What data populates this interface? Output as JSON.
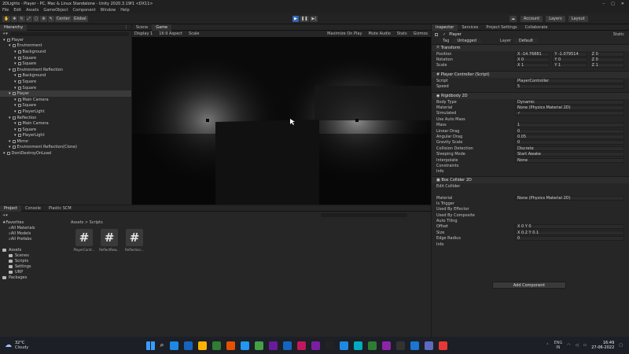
{
  "window": {
    "title": "2DLights - Player - PC, Mac & Linux Standalone - Unity 2020.3.19f1 <DX11>"
  },
  "menu": [
    "File",
    "Edit",
    "Assets",
    "GameObject",
    "Component",
    "Window",
    "Help"
  ],
  "toolbar": {
    "center_label": "Center",
    "global_label": "Global",
    "account_label": "Account",
    "layers_label": "Layers",
    "layout_label": "Layout"
  },
  "hierarchy": {
    "tab_label": "Hierarchy",
    "items": [
      {
        "label": "Player",
        "indent": 0,
        "selected": false
      },
      {
        "label": "Environment",
        "indent": 1,
        "selected": false
      },
      {
        "label": "Background",
        "indent": 2,
        "selected": false
      },
      {
        "label": "Square",
        "indent": 2,
        "selected": false
      },
      {
        "label": "Square",
        "indent": 2,
        "selected": false
      },
      {
        "label": "Environment Reflection",
        "indent": 1,
        "selected": false
      },
      {
        "label": "Background",
        "indent": 2,
        "selected": false
      },
      {
        "label": "Square",
        "indent": 2,
        "selected": false
      },
      {
        "label": "Square",
        "indent": 2,
        "selected": false
      },
      {
        "label": "Player",
        "indent": 1,
        "selected": true
      },
      {
        "label": "Main Camera",
        "indent": 2,
        "selected": false
      },
      {
        "label": "Square",
        "indent": 2,
        "selected": false
      },
      {
        "label": "PlayerLight",
        "indent": 2,
        "selected": false
      },
      {
        "label": "Reflection",
        "indent": 1,
        "selected": false
      },
      {
        "label": "Main Camera",
        "indent": 2,
        "selected": false
      },
      {
        "label": "Square",
        "indent": 2,
        "selected": false
      },
      {
        "label": "PlayerLight",
        "indent": 2,
        "selected": false
      },
      {
        "label": "Mirror",
        "indent": 1,
        "selected": false
      },
      {
        "label": "Environment Reflection(Clone)",
        "indent": 1,
        "selected": false
      },
      {
        "label": "DontDestroyOnLoad",
        "indent": 0,
        "selected": false
      }
    ]
  },
  "scene": {
    "tab_scene": "Scene",
    "tab_game": "Game",
    "display": "Display 1",
    "aspect": "16:9 Aspect",
    "scale": "Scale",
    "maximize": "Maximize On Play",
    "mute": "Mute Audio",
    "stats": "Stats",
    "gizmos": "Gizmos"
  },
  "project": {
    "tab_project": "Project",
    "tab_console": "Console",
    "tab_plastic": "Plastic SCM",
    "breadcrumb": "Assets > Scripts",
    "tree": [
      {
        "label": "Favorites",
        "indent": 0,
        "kind": "star"
      },
      {
        "label": "All Materials",
        "indent": 1,
        "kind": "search"
      },
      {
        "label": "All Models",
        "indent": 1,
        "kind": "search"
      },
      {
        "label": "All Prefabs",
        "indent": 1,
        "kind": "search"
      },
      {
        "label": "",
        "indent": 0,
        "kind": "spacer"
      },
      {
        "label": "Assets",
        "indent": 0,
        "kind": "folder"
      },
      {
        "label": "Scenes",
        "indent": 1,
        "kind": "folder"
      },
      {
        "label": "Scripts",
        "indent": 1,
        "kind": "folder"
      },
      {
        "label": "Settings",
        "indent": 1,
        "kind": "folder"
      },
      {
        "label": "URP",
        "indent": 1,
        "kind": "folder"
      },
      {
        "label": "Packages",
        "indent": 0,
        "kind": "folder"
      }
    ],
    "assets": [
      {
        "label": "PlayerContr..."
      },
      {
        "label": "ReflectRew..."
      },
      {
        "label": "Reflection..."
      }
    ]
  },
  "inspector": {
    "tab_inspector": "Inspector",
    "tab_services": "Services",
    "tab_project_settings": "Project Settings",
    "tab_collaborate": "Collaborate",
    "object_name": "Player",
    "static_label": "Static",
    "tag_label": "Tag",
    "tag_value": "Untagged",
    "layer_label": "Layer",
    "layer_value": "Default",
    "transform": {
      "title": "Transform",
      "position_label": "Position",
      "position": [
        "X -14.76881",
        "Y -1.079514",
        "Z 0"
      ],
      "rotation_label": "Rotation",
      "rotation": [
        "X 0",
        "Y 0",
        "Z 0"
      ],
      "scale_label": "Scale",
      "scale": [
        "X 1",
        "Y 1",
        "Z 1"
      ]
    },
    "player_controller": {
      "title": "Player Controller (Script)",
      "script_label": "Script",
      "script_value": "PlayerController",
      "speed_label": "Speed",
      "speed_value": "5"
    },
    "rigidbody": {
      "title": "Rigidbody 2D",
      "rows": [
        {
          "label": "Body Type",
          "value": "Dynamic"
        },
        {
          "label": "Material",
          "value": "None (Physics Material 2D)"
        },
        {
          "label": "Simulated",
          "value": "✓"
        },
        {
          "label": "Use Auto Mass",
          "value": ""
        },
        {
          "label": "Mass",
          "value": "1"
        },
        {
          "label": "Linear Drag",
          "value": "0"
        },
        {
          "label": "Angular Drag",
          "value": "0.05"
        },
        {
          "label": "Gravity Scale",
          "value": "0"
        },
        {
          "label": "Collision Detection",
          "value": "Discrete"
        },
        {
          "label": "Sleeping Mode",
          "value": "Start Awake"
        },
        {
          "label": "Interpolate",
          "value": "None"
        },
        {
          "label": "Constraints",
          "value": ""
        },
        {
          "label": "Info",
          "value": ""
        }
      ]
    },
    "box_collider": {
      "title": "Box Collider 2D",
      "rows": [
        {
          "label": "Edit Collider",
          "value": ""
        },
        {
          "label": "",
          "value": ""
        },
        {
          "label": "Material",
          "value": "None (Physics Material 2D)"
        },
        {
          "label": "Is Trigger",
          "value": ""
        },
        {
          "label": "Used By Effector",
          "value": ""
        },
        {
          "label": "Used By Composite",
          "value": ""
        },
        {
          "label": "Auto Tiling",
          "value": ""
        },
        {
          "label": "Offset",
          "value": "X 0     Y 0"
        },
        {
          "label": "Size",
          "value": "X 0.2     Y 0.1"
        },
        {
          "label": "Edge Radius",
          "value": "0"
        },
        {
          "label": "Info",
          "value": ""
        }
      ]
    },
    "add_component": "Add Component"
  },
  "taskbar": {
    "temperature": "32°C",
    "weather": "Cloudy",
    "lang": "ENG",
    "region": "IN",
    "time": "16:49",
    "date": "27-06-2022",
    "apps": [
      "#1e88e5",
      "#1565c0",
      "#ffb300",
      "#2e7d32",
      "#e65100",
      "#2196f3",
      "#43a047",
      "#6a1b9a",
      "#1565c0",
      "#c2185b",
      "#7b1fa2",
      "#222222",
      "#1e88e5",
      "#00acc1",
      "#2e7d32",
      "#8e24aa",
      "#333333",
      "#1976d2",
      "#5c6bc0",
      "#e53935"
    ]
  }
}
